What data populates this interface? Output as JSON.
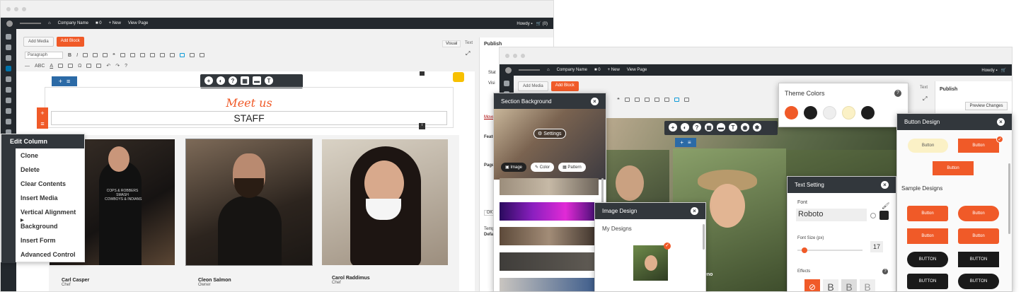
{
  "front": {
    "adminbar": {
      "site": "Company Name",
      "comments": "0",
      "new": "New",
      "view": "View Page",
      "howdy": "Howdy",
      "cart": "(0)"
    },
    "editor": {
      "add_media": "Add Media",
      "add_block": "Add Block",
      "tab_visual": "Visual",
      "tab_text": "Text",
      "format": "Paragraph"
    },
    "heading_script": "Meet us",
    "heading_main": "STAFF",
    "publish": {
      "title": "Publish",
      "feat": "Featu",
      "page": "Page",
      "ok": "OK",
      "templ": "Temp",
      "defa": "Defa",
      "move": "Move",
      "stat": "Stat",
      "visi": "Visi"
    },
    "staff": [
      {
        "name": "Carl Casper",
        "role": "Chef"
      },
      {
        "name": "Cleon Salmon",
        "role": "Owner"
      },
      {
        "name": "Carol Raddimus",
        "role": "Chef"
      }
    ],
    "shirt_text": "COPS & ROBBERS\nSMASH\nCOWBOYS & INDIANS",
    "menu": {
      "title": "Edit Column",
      "items": [
        "Clone",
        "Delete",
        "Clear Contents",
        "Insert Media",
        "Vertical Alignment",
        "Background",
        "Insert Form",
        "Advanced Control"
      ]
    }
  },
  "back": {
    "adminbar": {
      "site": "Company Name",
      "comments": "0",
      "new": "New",
      "view": "View Page",
      "howdy": "Howdy"
    },
    "editor": {
      "add_media": "Add Media",
      "add_block": "Add Block",
      "tab_text": "Text"
    },
    "publish": {
      "title": "Publish",
      "preview": "Preview Changes"
    },
    "theme_colors": {
      "title": "Theme Colors",
      "swatches": [
        "#f05a28",
        "#1e1e1e",
        "#eeeeee",
        "#fbf1c6",
        "#1e1e1e"
      ]
    },
    "section_bg": {
      "title": "Section Background",
      "settings": "Settings",
      "tabs": [
        "Image",
        "Color",
        "Pattern"
      ]
    },
    "image_design": {
      "title": "Image Design",
      "subtitle": "My Designs"
    },
    "text_setting": {
      "title": "Text Setting",
      "font_label": "Font",
      "font_value": "Roboto",
      "size_label": "Font Size (px)",
      "size_value": "17",
      "effects_label": "Effects",
      "effects": [
        "B",
        "B",
        "B"
      ],
      "partial": "eno"
    },
    "button_design": {
      "title": "Button Design",
      "button": "Button",
      "sample_title": "Sample Designs",
      "samples": [
        "Button",
        "Button",
        "Button",
        "Button",
        "BUTTON",
        "BUTTON",
        "BUTTON",
        "BUTTON"
      ]
    }
  }
}
